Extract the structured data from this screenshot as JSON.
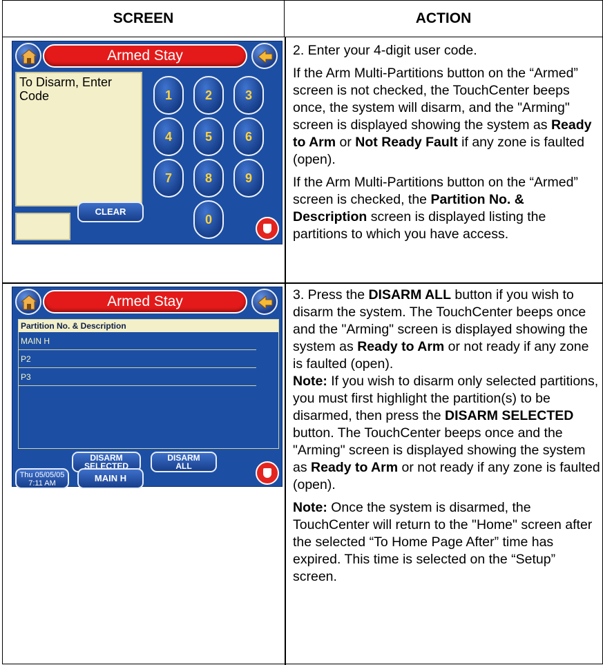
{
  "headers": {
    "screen": "SCREEN",
    "action": "ACTION"
  },
  "row1": {
    "device": {
      "title": "Armed Stay",
      "prompt": "To Disarm, Enter Code",
      "keys": [
        "1",
        "2",
        "3",
        "4",
        "5",
        "6",
        "7",
        "8",
        "9",
        "0"
      ],
      "clear_label": "CLEAR"
    },
    "action": {
      "p1": "2. Enter your 4-digit user code.",
      "p2_a": "If the Arm Multi-Partitions button on the “Armed” screen is not checked, the TouchCenter beeps once, the system will disarm, and the \"Arming\" screen is displayed showing the system as ",
      "p2_b1": "Ready to Arm",
      "p2_c": " or ",
      "p2_b2": "Not Ready Fault",
      "p2_d": " if any zone is faulted (open).",
      "p3_a": "If the Arm Multi-Partitions button on the “Armed” screen is checked, the ",
      "p3_b": "Partition No. & Description",
      "p3_c": " screen is displayed listing the partitions to which you have access."
    }
  },
  "row2": {
    "device": {
      "title": "Armed Stay",
      "list_header": "Partition No. & Description",
      "partitions": [
        "MAIN H",
        "P2",
        "P3"
      ],
      "disarm_selected_l1": "DISARM",
      "disarm_selected_l2": "SELECTED",
      "disarm_all_l1": "DISARM",
      "disarm_all_l2": "ALL",
      "date_l1": "Thu 05/05/05",
      "date_l2": "7:11 AM",
      "partition_button": "MAIN H"
    },
    "action": {
      "p1_a": "3.  Press the ",
      "p1_b": "DISARM ALL",
      "p1_c": " button if you wish to disarm the system.  The TouchCenter beeps once and the \"Arming\" screen is displayed showing the system as ",
      "p1_d": "Ready to Arm",
      "p1_e": " or not ready if any zone is faulted (open).",
      "note_label": "Note:",
      "p2_a": "  If you wish to disarm only selected partitions, you must first highlight the partition(s) to be disarmed, then press the ",
      "p2_b": "DISARM SELECTED",
      "p2_c": " button.   The TouchCenter beeps once and the \"Arming\" screen is displayed showing the system as ",
      "p2_d": "Ready to Arm",
      "p2_e": " or not ready if any zone is faulted (open).",
      "note2_label": "Note:",
      "p3": "  Once the system is disarmed, the TouchCenter will return to the \"Home\" screen after the selected “To Home Page After” time has expired.  This time is selected on the “Setup” screen."
    }
  }
}
